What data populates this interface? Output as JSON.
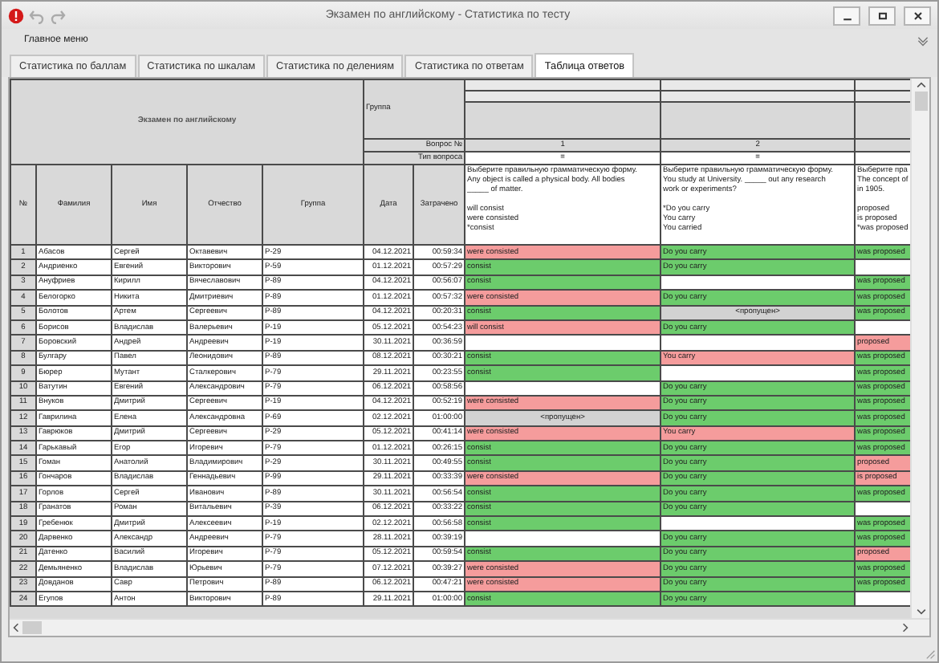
{
  "window": {
    "title": "Экзамен по английскому - Статистика по тесту"
  },
  "menu": {
    "label": "Главное меню"
  },
  "tabs": [
    {
      "label": "Статистика по баллам",
      "selected": false
    },
    {
      "label": "Статистика по шкалам",
      "selected": false
    },
    {
      "label": "Статистика по делениям",
      "selected": false
    },
    {
      "label": "Статистика по ответам",
      "selected": false
    },
    {
      "label": "Таблица ответов",
      "selected": true
    }
  ],
  "table": {
    "title": "Экзамен по английскому",
    "group_label": "Группа",
    "question_number_label": "Вопрос №",
    "question_type_label": "Тип вопроса",
    "columns": [
      "№",
      "Фамилия",
      "Имя",
      "Отчество",
      "Группа",
      "Дата",
      "Затрачено"
    ],
    "questions": [
      {
        "number": "1",
        "type": "≡",
        "lines": [
          "Выберите правильную грамматическую форму.",
          "Any object is called a physical body. All bodies",
          "_____ of matter."
        ],
        "options": [
          "will consist",
          "were consisted",
          "*consist"
        ]
      },
      {
        "number": "2",
        "type": "≡",
        "lines": [
          "Выберите правильную грамматическую форму.",
          "You study at University. _____ out any research",
          "work or experiments?"
        ],
        "options": [
          "*Do you carry",
          "You carry",
          "You carried"
        ]
      },
      {
        "lines": [
          "Выберите пра",
          "The concept of",
          "in 1905."
        ],
        "options": [
          "proposed",
          "is proposed",
          "*was proposed"
        ]
      }
    ],
    "rows": [
      {
        "number": "1",
        "surname": "Абасов",
        "name": "Сергей",
        "patronymic": "Октавевич",
        "group": "Р-29",
        "date": "04.12.2021",
        "time_spent": "00:59:34",
        "answers": [
          {
            "text": "were consisted",
            "kind": "wrong"
          },
          {
            "text": "Do you carry",
            "kind": "correct"
          },
          {
            "text": "was proposed",
            "kind": "correct"
          }
        ]
      },
      {
        "number": "2",
        "surname": "Андриенко",
        "name": "Евгений",
        "patronymic": "Викторович",
        "group": "Р-59",
        "date": "01.12.2021",
        "time_spent": "00:57:29",
        "answers": [
          {
            "text": "consist",
            "kind": "correct"
          },
          {
            "text": "Do you carry",
            "kind": "correct"
          },
          {
            "kind": "empty"
          }
        ]
      },
      {
        "number": "3",
        "surname": "Ануфриев",
        "name": "Кирилл",
        "patronymic": "Вячеславович",
        "group": "Р-89",
        "date": "04.12.2021",
        "time_spent": "00:56:07",
        "answers": [
          {
            "text": "consist",
            "kind": "correct"
          },
          {
            "kind": "empty"
          },
          {
            "text": "was proposed",
            "kind": "correct"
          }
        ]
      },
      {
        "number": "4",
        "surname": "Белогорко",
        "name": "Никита",
        "patronymic": "Дмитриевич",
        "group": "Р-89",
        "date": "01.12.2021",
        "time_spent": "00:57:32",
        "answers": [
          {
            "text": "were consisted",
            "kind": "wrong"
          },
          {
            "text": "Do you carry",
            "kind": "correct"
          },
          {
            "text": "was proposed",
            "kind": "correct"
          }
        ]
      },
      {
        "number": "5",
        "surname": "Болотов",
        "name": "Артем",
        "patronymic": "Сергеевич",
        "group": "Р-89",
        "date": "04.12.2021",
        "time_spent": "00:20:31",
        "answers": [
          {
            "text": "consist",
            "kind": "correct"
          },
          {
            "text": "<пропущен>",
            "kind": "skipped"
          },
          {
            "text": "was proposed",
            "kind": "correct"
          }
        ]
      },
      {
        "number": "6",
        "surname": "Борисов",
        "name": "Владислав",
        "patronymic": "Валерьевич",
        "group": "Р-19",
        "date": "05.12.2021",
        "time_spent": "00:54:23",
        "answers": [
          {
            "text": "will consist",
            "kind": "wrong"
          },
          {
            "text": "Do you carry",
            "kind": "correct"
          },
          {
            "kind": "empty"
          }
        ]
      },
      {
        "number": "7",
        "surname": "Боровский",
        "name": "Андрей",
        "patronymic": "Андреевич",
        "group": "Р-19",
        "date": "30.11.2021",
        "time_spent": "00:36:59",
        "answers": [
          {
            "kind": "empty"
          },
          {
            "kind": "empty"
          },
          {
            "text": "proposed",
            "kind": "wrong"
          }
        ]
      },
      {
        "number": "8",
        "surname": "Булгару",
        "name": "Павел",
        "patronymic": "Леонидович",
        "group": "Р-89",
        "date": "08.12.2021",
        "time_spent": "00:30:21",
        "answers": [
          {
            "text": "consist",
            "kind": "correct"
          },
          {
            "text": "You carry",
            "kind": "wrong"
          },
          {
            "text": "was proposed",
            "kind": "correct"
          }
        ]
      },
      {
        "number": "9",
        "surname": "Бюрер",
        "name": "Мутант",
        "patronymic": "Сталкерович",
        "group": "Р-79",
        "date": "29.11.2021",
        "time_spent": "00:23:55",
        "answers": [
          {
            "text": "consist",
            "kind": "correct"
          },
          {
            "kind": "empty"
          },
          {
            "text": "was proposed",
            "kind": "correct"
          }
        ]
      },
      {
        "number": "10",
        "surname": "Ватутин",
        "name": "Евгений",
        "patronymic": "Александрович",
        "group": "Р-79",
        "date": "06.12.2021",
        "time_spent": "00:58:56",
        "answers": [
          {
            "kind": "empty"
          },
          {
            "text": "Do you carry",
            "kind": "correct"
          },
          {
            "text": "was proposed",
            "kind": "correct"
          }
        ]
      },
      {
        "number": "11",
        "surname": "Внуков",
        "name": "Дмитрий",
        "patronymic": "Сергеевич",
        "group": "Р-19",
        "date": "04.12.2021",
        "time_spent": "00:52:19",
        "answers": [
          {
            "text": "were consisted",
            "kind": "wrong"
          },
          {
            "text": "Do you carry",
            "kind": "correct"
          },
          {
            "text": "was proposed",
            "kind": "correct"
          }
        ]
      },
      {
        "number": "12",
        "surname": "Гаврилина",
        "name": "Елена",
        "patronymic": "Александровна",
        "group": "Р-69",
        "date": "02.12.2021",
        "time_spent": "01:00:00",
        "answers": [
          {
            "text": "<пропущен>",
            "kind": "skipped"
          },
          {
            "text": "Do you carry",
            "kind": "correct"
          },
          {
            "text": "was proposed",
            "kind": "correct"
          }
        ]
      },
      {
        "number": "13",
        "surname": "Гаврюков",
        "name": "Дмитрий",
        "patronymic": "Сергеевич",
        "group": "Р-29",
        "date": "05.12.2021",
        "time_spent": "00:41:14",
        "answers": [
          {
            "text": "were consisted",
            "kind": "wrong"
          },
          {
            "text": "You carry",
            "kind": "wrong"
          },
          {
            "text": "was proposed",
            "kind": "correct"
          }
        ]
      },
      {
        "number": "14",
        "surname": "Гарькавый",
        "name": "Егор",
        "patronymic": "Игоревич",
        "group": "Р-79",
        "date": "01.12.2021",
        "time_spent": "00:26:15",
        "answers": [
          {
            "text": "consist",
            "kind": "correct"
          },
          {
            "text": "Do you carry",
            "kind": "correct"
          },
          {
            "text": "was proposed",
            "kind": "correct"
          }
        ]
      },
      {
        "number": "15",
        "surname": "Гоман",
        "name": "Анатолий",
        "patronymic": "Владимирович",
        "group": "Р-29",
        "date": "30.11.2021",
        "time_spent": "00:49:55",
        "answers": [
          {
            "text": "consist",
            "kind": "correct"
          },
          {
            "text": "Do you carry",
            "kind": "correct"
          },
          {
            "text": "proposed",
            "kind": "wrong"
          }
        ]
      },
      {
        "number": "16",
        "surname": "Гончаров",
        "name": "Владислав",
        "patronymic": "Геннадьевич",
        "group": "Р-99",
        "date": "29.11.2021",
        "time_spent": "00:33:39",
        "answers": [
          {
            "text": "were consisted",
            "kind": "wrong"
          },
          {
            "text": "Do you carry",
            "kind": "correct"
          },
          {
            "text": "is proposed",
            "kind": "wrong"
          }
        ]
      },
      {
        "number": "17",
        "surname": "Горлов",
        "name": "Сергей",
        "patronymic": "Иванович",
        "group": "Р-89",
        "date": "30.11.2021",
        "time_spent": "00:56:54",
        "answers": [
          {
            "text": "consist",
            "kind": "correct"
          },
          {
            "text": "Do you carry",
            "kind": "correct"
          },
          {
            "text": "was proposed",
            "kind": "correct"
          }
        ]
      },
      {
        "number": "18",
        "surname": "Гранатов",
        "name": "Роман",
        "patronymic": "Витальевич",
        "group": "Р-39",
        "date": "06.12.2021",
        "time_spent": "00:33:22",
        "answers": [
          {
            "text": "consist",
            "kind": "correct"
          },
          {
            "text": "Do you carry",
            "kind": "correct"
          },
          {
            "kind": "empty"
          }
        ]
      },
      {
        "number": "19",
        "surname": "Гребенюк",
        "name": "Дмитрий",
        "patronymic": "Алексеевич",
        "group": "Р-19",
        "date": "02.12.2021",
        "time_spent": "00:56:58",
        "answers": [
          {
            "text": "consist",
            "kind": "correct"
          },
          {
            "kind": "empty"
          },
          {
            "text": "was proposed",
            "kind": "correct"
          }
        ]
      },
      {
        "number": "20",
        "surname": "Дарвенко",
        "name": "Александр",
        "patronymic": "Андреевич",
        "group": "Р-79",
        "date": "28.11.2021",
        "time_spent": "00:39:19",
        "answers": [
          {
            "kind": "empty"
          },
          {
            "text": "Do you carry",
            "kind": "correct"
          },
          {
            "text": "was proposed",
            "kind": "correct"
          }
        ]
      },
      {
        "number": "21",
        "surname": "Датенко",
        "name": "Василий",
        "patronymic": "Игоревич",
        "group": "Р-79",
        "date": "05.12.2021",
        "time_spent": "00:59:54",
        "answers": [
          {
            "text": "consist",
            "kind": "correct"
          },
          {
            "text": "Do you carry",
            "kind": "correct"
          },
          {
            "text": "proposed",
            "kind": "wrong"
          }
        ]
      },
      {
        "number": "22",
        "surname": "Демьяненко",
        "name": "Владислав",
        "patronymic": "Юрьевич",
        "group": "Р-79",
        "date": "07.12.2021",
        "time_spent": "00:39:27",
        "answers": [
          {
            "text": "were consisted",
            "kind": "wrong"
          },
          {
            "text": "Do you carry",
            "kind": "correct"
          },
          {
            "text": "was proposed",
            "kind": "correct"
          }
        ]
      },
      {
        "number": "23",
        "surname": "Довданов",
        "name": "Савр",
        "patronymic": "Петрович",
        "group": "Р-89",
        "date": "06.12.2021",
        "time_spent": "00:47:21",
        "answers": [
          {
            "text": "were consisted",
            "kind": "wrong"
          },
          {
            "text": "Do you carry",
            "kind": "correct"
          },
          {
            "text": "was proposed",
            "kind": "correct"
          }
        ]
      },
      {
        "number": "24",
        "surname": "Егупов",
        "name": "Антон",
        "patronymic": "Викторович",
        "group": "Р-89",
        "date": "29.11.2021",
        "time_spent": "01:00:00",
        "answers": [
          {
            "text": "consist",
            "kind": "correct"
          },
          {
            "text": "Do you carry",
            "kind": "correct"
          },
          {
            "kind": "empty"
          }
        ]
      }
    ]
  }
}
